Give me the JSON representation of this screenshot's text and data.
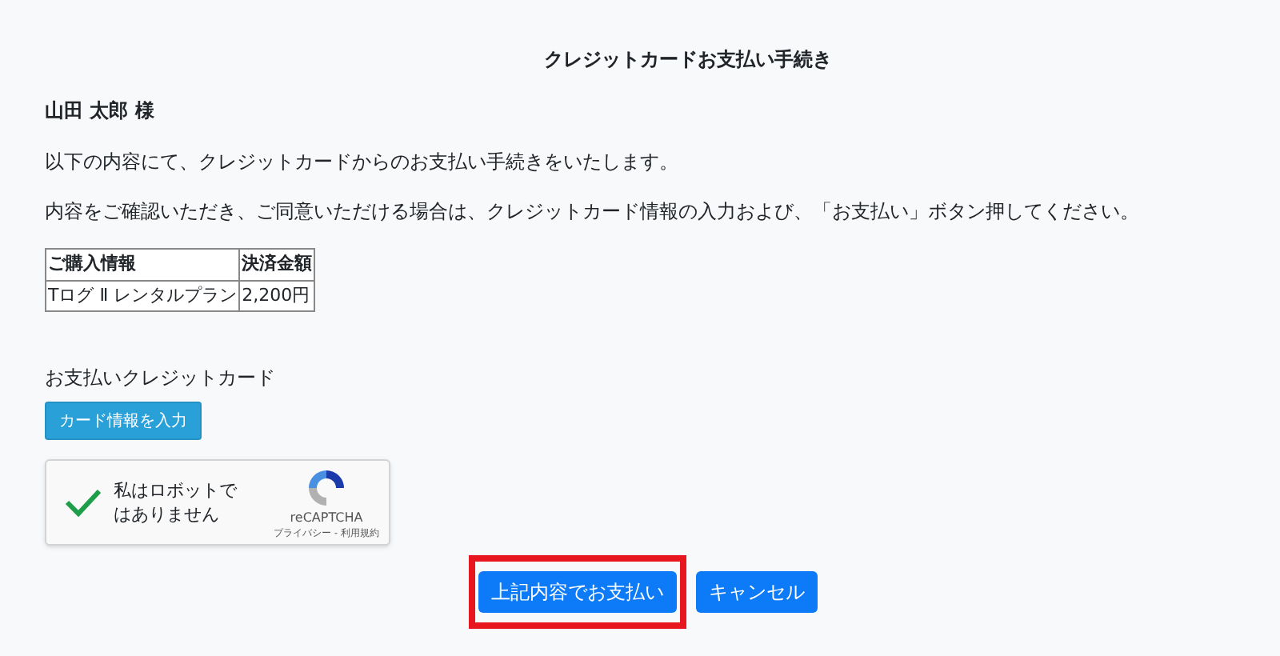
{
  "title": "クレジットカードお支払い手続き",
  "customer_name": "山田 太郎 様",
  "paragraphs": [
    "以下の内容にて、クレジットカードからのお支払い手続きをいたします。",
    "内容をご確認いただき、ご同意いただける場合は、クレジットカード情報の入力および、「お支払い」ボタン押してください。"
  ],
  "table": {
    "columns": [
      "ご購入情報",
      "決済金額"
    ],
    "rows": [
      [
        "Tログ Ⅱ レンタルプラン",
        "2,200円"
      ]
    ]
  },
  "card_section": {
    "label": "お支払いクレジットカード",
    "button": "カード情報を入力"
  },
  "captcha": {
    "checked": true,
    "label": "私はロボットではありません",
    "brand": "reCAPTCHA",
    "links": "プライバシー - 利用規約"
  },
  "actions": [
    {
      "label": "上記内容でお支払い",
      "highlighted": true
    },
    {
      "label": "キャンセル",
      "highlighted": false
    }
  ]
}
